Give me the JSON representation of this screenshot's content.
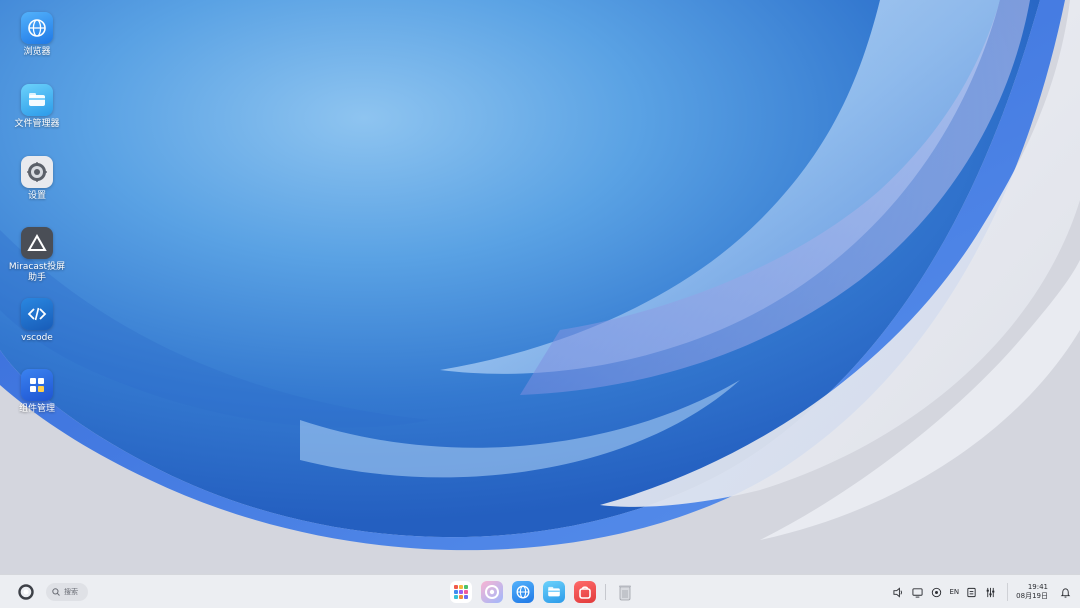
{
  "desktop": {
    "icons": [
      {
        "id": "browser",
        "label": "浏览器",
        "icon": "globe-icon",
        "color": "#2b8ef0"
      },
      {
        "id": "files",
        "label": "文件管理器",
        "icon": "folder-icon",
        "color": "#3aa8f2"
      },
      {
        "id": "settings",
        "label": "设置",
        "icon": "gear-icon",
        "color": "#5c6068"
      },
      {
        "id": "miracast",
        "label": "Miracast投屏助手",
        "icon": "triangle-icon",
        "color": "#4b4f57"
      },
      {
        "id": "vscode",
        "label": "vscode",
        "icon": "code-icon",
        "color": "#1f6fc8"
      },
      {
        "id": "widgets",
        "label": "组件管理",
        "icon": "grid-icon",
        "color": "#2d6fe6"
      }
    ]
  },
  "taskbar": {
    "start_icon": "start-ring-icon",
    "search": {
      "label": "搜索",
      "icon": "search-icon"
    },
    "dock": [
      {
        "id": "launcher",
        "icon": "app-grid-icon"
      },
      {
        "id": "assistant",
        "icon": "assistant-icon"
      },
      {
        "id": "browser",
        "icon": "globe-icon"
      },
      {
        "id": "files",
        "icon": "folder-icon"
      },
      {
        "id": "store",
        "icon": "store-icon"
      },
      {
        "id": "trash",
        "icon": "trash-icon"
      }
    ],
    "tray": {
      "volume_icon": "volume-icon",
      "display_icon": "display-icon",
      "network_icon": "network-icon",
      "input_method": "EN",
      "clipboard_icon": "clipboard-icon",
      "control_icon": "sliders-icon"
    },
    "clock": {
      "time": "19:41",
      "date": "08月19日"
    },
    "notification_icon": "bell-icon"
  },
  "colors": {
    "taskbar_bg": "#eceef2",
    "wallpaper_blue": "#3a86d8",
    "wallpaper_light": "#d8dae2"
  }
}
